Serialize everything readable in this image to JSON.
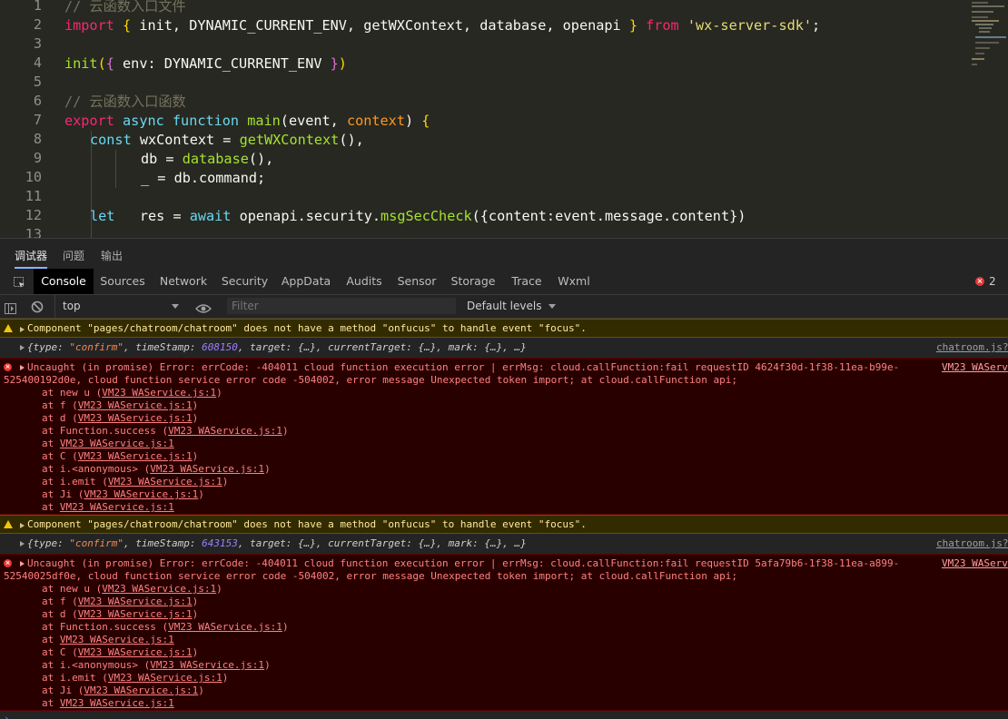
{
  "editor": {
    "line_numbers": [
      "1",
      "2",
      "3",
      "4",
      "5",
      "6",
      "7",
      "8",
      "9",
      "10",
      "11",
      "12",
      "13"
    ],
    "l1_comment": "// 云函数入口文件",
    "l2": {
      "import": "import",
      "open": "{",
      "names": " init, DYNAMIC_CURRENT_ENV, getWXContext, database, openapi ",
      "close": "}",
      "from": "from",
      "module": "'wx-server-sdk'",
      "semi": ";"
    },
    "l4": {
      "fn": "init",
      "p1": "(",
      "b1": "{",
      "body": " env: DYNAMIC_CURRENT_ENV ",
      "b2": "}",
      "p2": ")"
    },
    "l6_comment": "// 云函数入口函数",
    "l7": {
      "export": "export",
      "async": "async",
      "function": "function",
      "name": "main",
      "args_open": "(event, ",
      "context": "context",
      "args_close": ") ",
      "brace": "{"
    },
    "l8": {
      "const": "const",
      "var": " wxContext = ",
      "call": "getWXContext",
      "rest": "(),"
    },
    "l9": {
      "var": "db = ",
      "call": "database",
      "rest": "(),"
    },
    "l10": {
      "text": "_ = db.command;"
    },
    "l12": {
      "let": "let",
      "var": "   res = ",
      "await": "await",
      "obj": " openapi.security.",
      "call": "msgSecCheck",
      "args": "({content:event.message.content})"
    }
  },
  "panel_tabs": [
    "调试器",
    "问题",
    "输出"
  ],
  "devtools_tabs": [
    "Console",
    "Sources",
    "Network",
    "Security",
    "AppData",
    "Audits",
    "Sensor",
    "Storage",
    "Trace",
    "Wxml"
  ],
  "error_count": "2",
  "toolbar": {
    "context": "top",
    "filter_placeholder": "Filter",
    "levels": "Default levels"
  },
  "console": {
    "warn_text": "Component \"pages/chatroom/chatroom\" does not have a method \"onfucus\" to handle event \"focus\".",
    "events": [
      {
        "type": "confirm",
        "timestamp": "608150",
        "source": "chatroom.js?"
      },
      {
        "type": "confirm",
        "timestamp": "643153",
        "source": "chatroom.js?"
      }
    ],
    "event_labels": {
      "open": "{",
      "type": "type: ",
      "ts": ", timeStamp: ",
      "rest": ", target: {…}, currentTarget: {…}, mark: {…}, …}"
    },
    "errors": [
      {
        "line1": "Uncaught (in promise) Error: errCode: -404011 cloud function execution error | errMsg: cloud.callFunction:fail requestID 4624f30d-1f38-11ea-b99e-",
        "line2": "525400192d0e, cloud function service error code -504002, error message Unexpected token import; at cloud.callFunction api;",
        "source": "VM23 WAServ"
      },
      {
        "line1": "Uncaught (in promise) Error: errCode: -404011 cloud function execution error | errMsg: cloud.callFunction:fail requestID 5afa79b6-1f38-11ea-a899-",
        "line2": "52540025df0e, cloud function service error code -504002, error message Unexpected token import; at cloud.callFunction api;",
        "source": "VM23 WAServ"
      }
    ],
    "stack_file": "VM23 WAService.js:1",
    "stack": [
      "new u",
      "f",
      "d",
      "Function.success",
      "",
      "C",
      "i.<anonymous>",
      "i.emit",
      "Ji",
      ""
    ]
  }
}
